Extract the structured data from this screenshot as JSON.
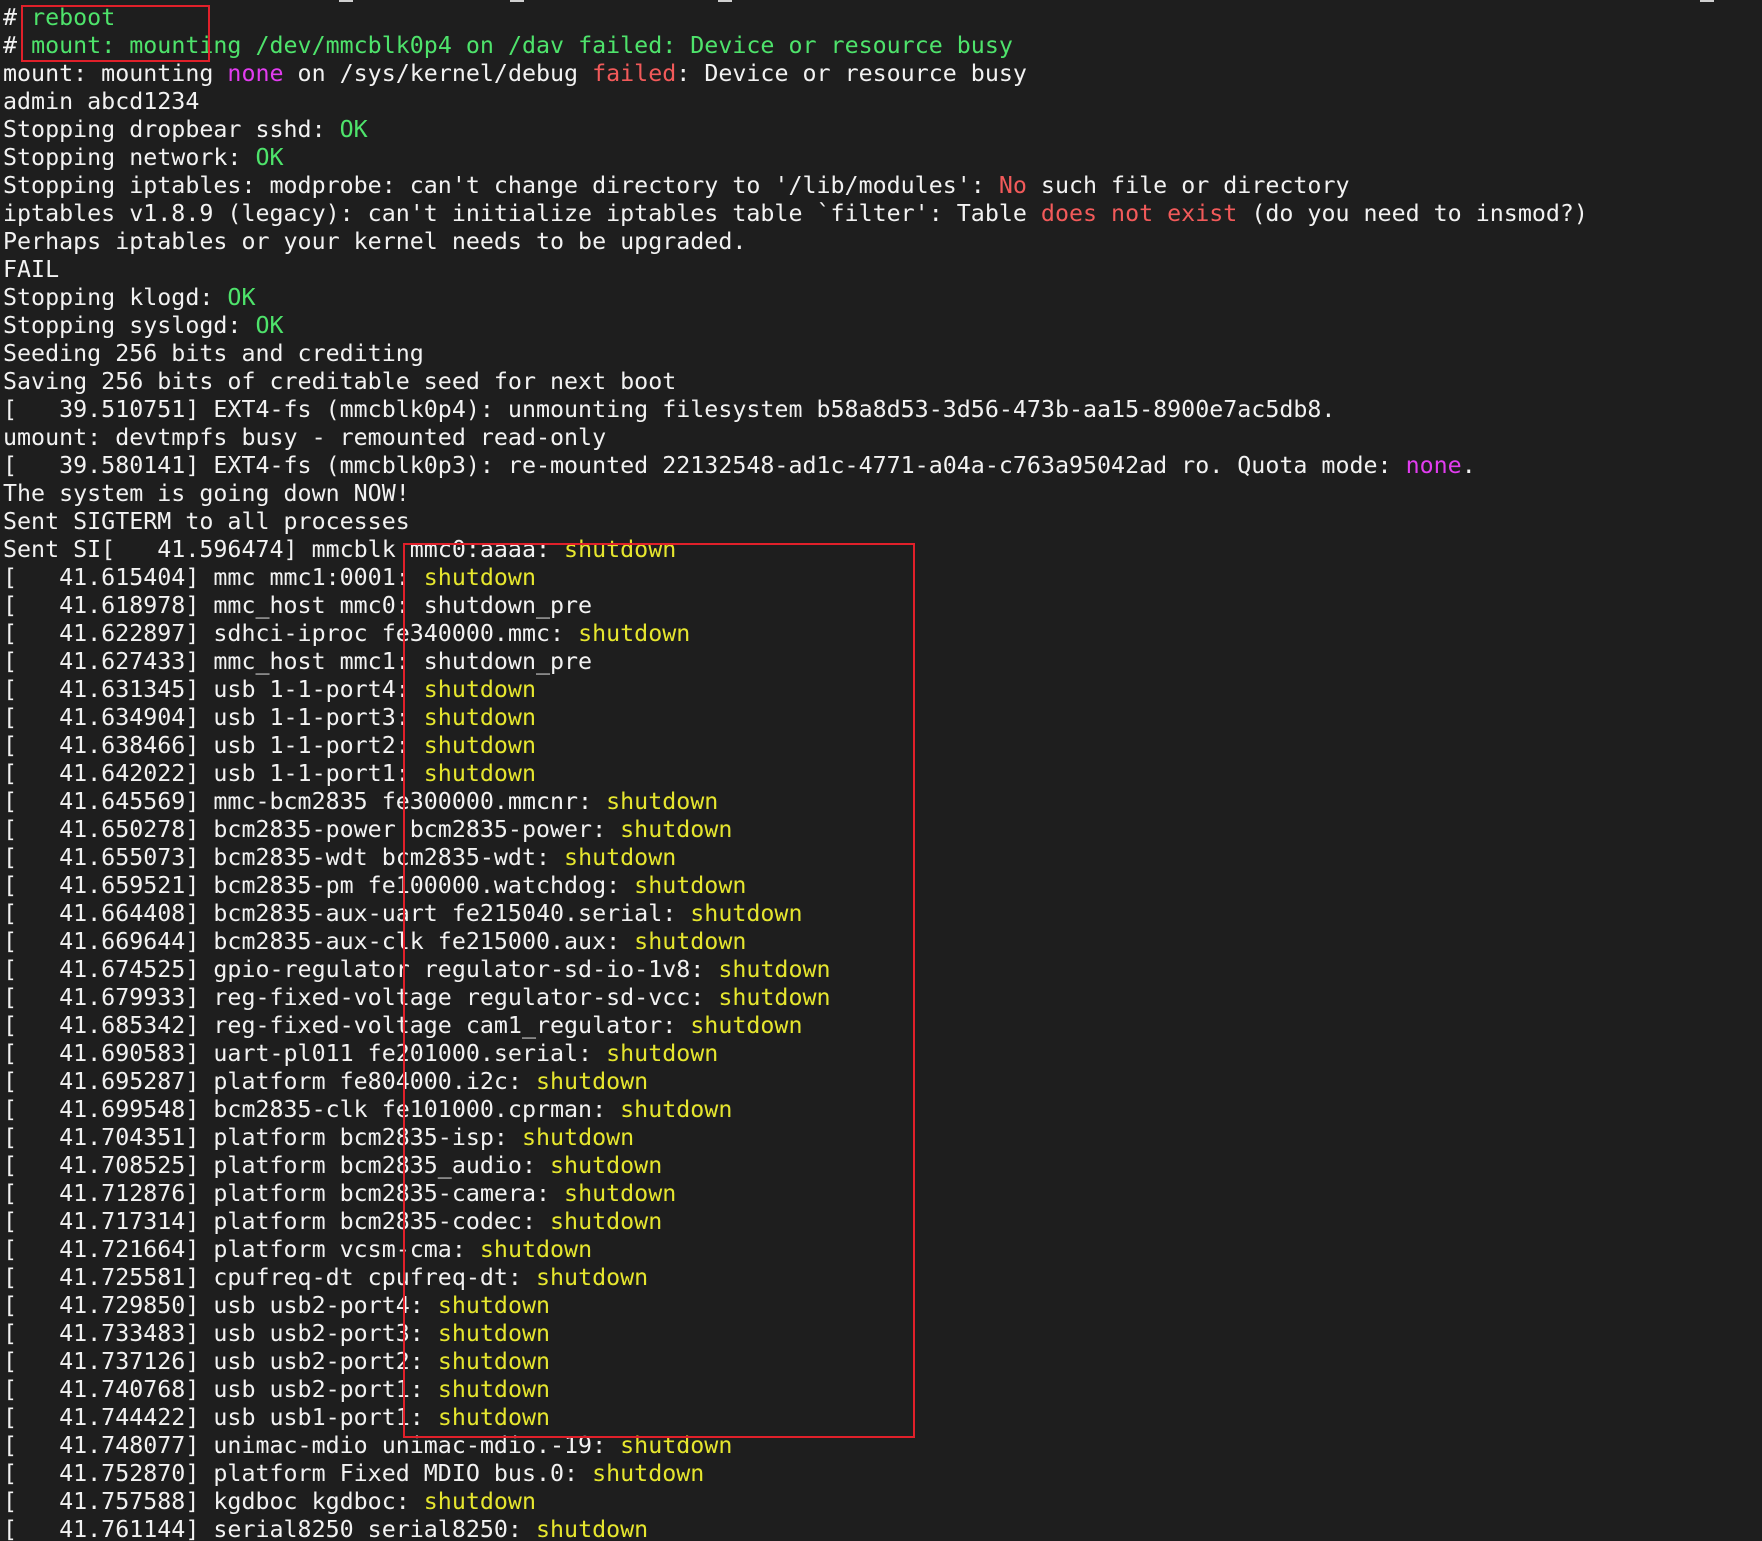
{
  "colors": {
    "background": "#1e1e1e",
    "text": "#f2f2f2",
    "ok_green": "#4ee36b",
    "shutdown_yellow": "#e6e62e",
    "none_magenta": "#e23cf0",
    "error_red": "#f25a5a",
    "annotation_box": "#e0202a"
  },
  "terminal": {
    "lines": [
      [
        {
          "t": "# ",
          "c": "white"
        },
        {
          "t": "reboot",
          "c": "green"
        }
      ],
      [
        {
          "t": "# ",
          "c": "white"
        },
        {
          "t": "mount: mounting /dev/mmcblk0p4 on /dav failed: Device or resource busy",
          "c": "green"
        }
      ],
      [
        {
          "t": "mount: mounting ",
          "c": "white"
        },
        {
          "t": "none",
          "c": "magenta"
        },
        {
          "t": " on /sys/kernel/debug ",
          "c": "white"
        },
        {
          "t": "failed",
          "c": "red"
        },
        {
          "t": ": Device or resource busy",
          "c": "white"
        }
      ],
      [
        {
          "t": "admin abcd1234",
          "c": "white"
        }
      ],
      [
        {
          "t": "Stopping dropbear sshd: ",
          "c": "white"
        },
        {
          "t": "OK",
          "c": "green"
        }
      ],
      [
        {
          "t": "Stopping network: ",
          "c": "white"
        },
        {
          "t": "OK",
          "c": "green"
        }
      ],
      [
        {
          "t": "Stopping iptables: modprobe: can't change directory to '/lib/modules': ",
          "c": "white"
        },
        {
          "t": "No",
          "c": "red"
        },
        {
          "t": " such file or directory",
          "c": "white"
        }
      ],
      [
        {
          "t": "iptables v1.8.9 (legacy): can't initialize iptables table `filter': Table ",
          "c": "white"
        },
        {
          "t": "does not exist",
          "c": "red"
        },
        {
          "t": " (do you need to insmod?)",
          "c": "white"
        }
      ],
      [
        {
          "t": "Perhaps iptables or your kernel needs to be upgraded.",
          "c": "white"
        }
      ],
      [
        {
          "t": "FAIL",
          "c": "white"
        }
      ],
      [
        {
          "t": "Stopping klogd: ",
          "c": "white"
        },
        {
          "t": "OK",
          "c": "green"
        }
      ],
      [
        {
          "t": "Stopping syslogd: ",
          "c": "white"
        },
        {
          "t": "OK",
          "c": "green"
        }
      ],
      [
        {
          "t": "Seeding 256 bits and crediting",
          "c": "white"
        }
      ],
      [
        {
          "t": "Saving 256 bits of creditable seed for next boot",
          "c": "white"
        }
      ],
      [
        {
          "t": "[   39.510751] EXT4-fs (mmcblk0p4): unmounting filesystem b58a8d53-3d56-473b-aa15-8900e7ac5db8.",
          "c": "white"
        }
      ],
      [
        {
          "t": "umount: devtmpfs busy - remounted read-only",
          "c": "white"
        }
      ],
      [
        {
          "t": "[   39.580141] EXT4-fs (mmcblk0p3): re-mounted 22132548-ad1c-4771-a04a-c763a95042ad ro. Quota mode: ",
          "c": "white"
        },
        {
          "t": "none",
          "c": "magenta"
        },
        {
          "t": ".",
          "c": "white"
        }
      ],
      [
        {
          "t": "The system is going down NOW!",
          "c": "white"
        }
      ],
      [
        {
          "t": "Sent SIGTERM to all processes",
          "c": "white"
        }
      ],
      [
        {
          "t": "Sent SI[   41.596474] mmcblk mmc0:aaaa: ",
          "c": "white"
        },
        {
          "t": "shutdown",
          "c": "yellow"
        }
      ],
      [
        {
          "t": "[   41.615404] mmc mmc1:0001: ",
          "c": "white"
        },
        {
          "t": "shutdown",
          "c": "yellow"
        }
      ],
      [
        {
          "t": "[   41.618978] mmc_host mmc0: shutdown_pre",
          "c": "white"
        }
      ],
      [
        {
          "t": "[   41.622897] sdhci-iproc fe340000.mmc: ",
          "c": "white"
        },
        {
          "t": "shutdown",
          "c": "yellow"
        }
      ],
      [
        {
          "t": "[   41.627433] mmc_host mmc1: shutdown_pre",
          "c": "white"
        }
      ],
      [
        {
          "t": "[   41.631345] usb 1-1-port4: ",
          "c": "white"
        },
        {
          "t": "shutdown",
          "c": "yellow"
        }
      ],
      [
        {
          "t": "[   41.634904] usb 1-1-port3: ",
          "c": "white"
        },
        {
          "t": "shutdown",
          "c": "yellow"
        }
      ],
      [
        {
          "t": "[   41.638466] usb 1-1-port2: ",
          "c": "white"
        },
        {
          "t": "shutdown",
          "c": "yellow"
        }
      ],
      [
        {
          "t": "[   41.642022] usb 1-1-port1: ",
          "c": "white"
        },
        {
          "t": "shutdown",
          "c": "yellow"
        }
      ],
      [
        {
          "t": "[   41.645569] mmc-bcm2835 fe300000.mmcnr: ",
          "c": "white"
        },
        {
          "t": "shutdown",
          "c": "yellow"
        }
      ],
      [
        {
          "t": "[   41.650278] bcm2835-power bcm2835-power: ",
          "c": "white"
        },
        {
          "t": "shutdown",
          "c": "yellow"
        }
      ],
      [
        {
          "t": "[   41.655073] bcm2835-wdt bcm2835-wdt: ",
          "c": "white"
        },
        {
          "t": "shutdown",
          "c": "yellow"
        }
      ],
      [
        {
          "t": "[   41.659521] bcm2835-pm fe100000.watchdog: ",
          "c": "white"
        },
        {
          "t": "shutdown",
          "c": "yellow"
        }
      ],
      [
        {
          "t": "[   41.664408] bcm2835-aux-uart fe215040.serial: ",
          "c": "white"
        },
        {
          "t": "shutdown",
          "c": "yellow"
        }
      ],
      [
        {
          "t": "[   41.669644] bcm2835-aux-clk fe215000.aux: ",
          "c": "white"
        },
        {
          "t": "shutdown",
          "c": "yellow"
        }
      ],
      [
        {
          "t": "[   41.674525] gpio-regulator regulator-sd-io-1v8: ",
          "c": "white"
        },
        {
          "t": "shutdown",
          "c": "yellow"
        }
      ],
      [
        {
          "t": "[   41.679933] reg-fixed-voltage regulator-sd-vcc: ",
          "c": "white"
        },
        {
          "t": "shutdown",
          "c": "yellow"
        }
      ],
      [
        {
          "t": "[   41.685342] reg-fixed-voltage cam1_regulator: ",
          "c": "white"
        },
        {
          "t": "shutdown",
          "c": "yellow"
        }
      ],
      [
        {
          "t": "[   41.690583] uart-pl011 fe201000.serial: ",
          "c": "white"
        },
        {
          "t": "shutdown",
          "c": "yellow"
        }
      ],
      [
        {
          "t": "[   41.695287] platform fe804000.i2c: ",
          "c": "white"
        },
        {
          "t": "shutdown",
          "c": "yellow"
        }
      ],
      [
        {
          "t": "[   41.699548] bcm2835-clk fe101000.cprman: ",
          "c": "white"
        },
        {
          "t": "shutdown",
          "c": "yellow"
        }
      ],
      [
        {
          "t": "[   41.704351] platform bcm2835-isp: ",
          "c": "white"
        },
        {
          "t": "shutdown",
          "c": "yellow"
        }
      ],
      [
        {
          "t": "[   41.708525] platform bcm2835_audio: ",
          "c": "white"
        },
        {
          "t": "shutdown",
          "c": "yellow"
        }
      ],
      [
        {
          "t": "[   41.712876] platform bcm2835-camera: ",
          "c": "white"
        },
        {
          "t": "shutdown",
          "c": "yellow"
        }
      ],
      [
        {
          "t": "[   41.717314] platform bcm2835-codec: ",
          "c": "white"
        },
        {
          "t": "shutdown",
          "c": "yellow"
        }
      ],
      [
        {
          "t": "[   41.721664] platform vcsm-cma: ",
          "c": "white"
        },
        {
          "t": "shutdown",
          "c": "yellow"
        }
      ],
      [
        {
          "t": "[   41.725581] cpufreq-dt cpufreq-dt: ",
          "c": "white"
        },
        {
          "t": "shutdown",
          "c": "yellow"
        }
      ],
      [
        {
          "t": "[   41.729850] usb usb2-port4: ",
          "c": "white"
        },
        {
          "t": "shutdown",
          "c": "yellow"
        }
      ],
      [
        {
          "t": "[   41.733483] usb usb2-port3: ",
          "c": "white"
        },
        {
          "t": "shutdown",
          "c": "yellow"
        }
      ],
      [
        {
          "t": "[   41.737126] usb usb2-port2: ",
          "c": "white"
        },
        {
          "t": "shutdown",
          "c": "yellow"
        }
      ],
      [
        {
          "t": "[   41.740768] usb usb2-port1: ",
          "c": "white"
        },
        {
          "t": "shutdown",
          "c": "yellow"
        }
      ],
      [
        {
          "t": "[   41.744422] usb usb1-port1: ",
          "c": "white"
        },
        {
          "t": "shutdown",
          "c": "yellow"
        }
      ],
      [
        {
          "t": "[   41.748077] unimac-mdio unimac-mdio.-19: ",
          "c": "white"
        },
        {
          "t": "shutdown",
          "c": "yellow"
        }
      ],
      [
        {
          "t": "[   41.752870] platform Fixed MDIO bus.0: ",
          "c": "white"
        },
        {
          "t": "shutdown",
          "c": "yellow"
        }
      ],
      [
        {
          "t": "[   41.757588] kgdboc kgdboc: ",
          "c": "white"
        },
        {
          "t": "shutdown",
          "c": "yellow"
        }
      ],
      [
        {
          "t": "[   41.761144] serial8250 serial8250: ",
          "c": "white"
        },
        {
          "t": "shutdown",
          "c": "yellow"
        }
      ]
    ]
  }
}
